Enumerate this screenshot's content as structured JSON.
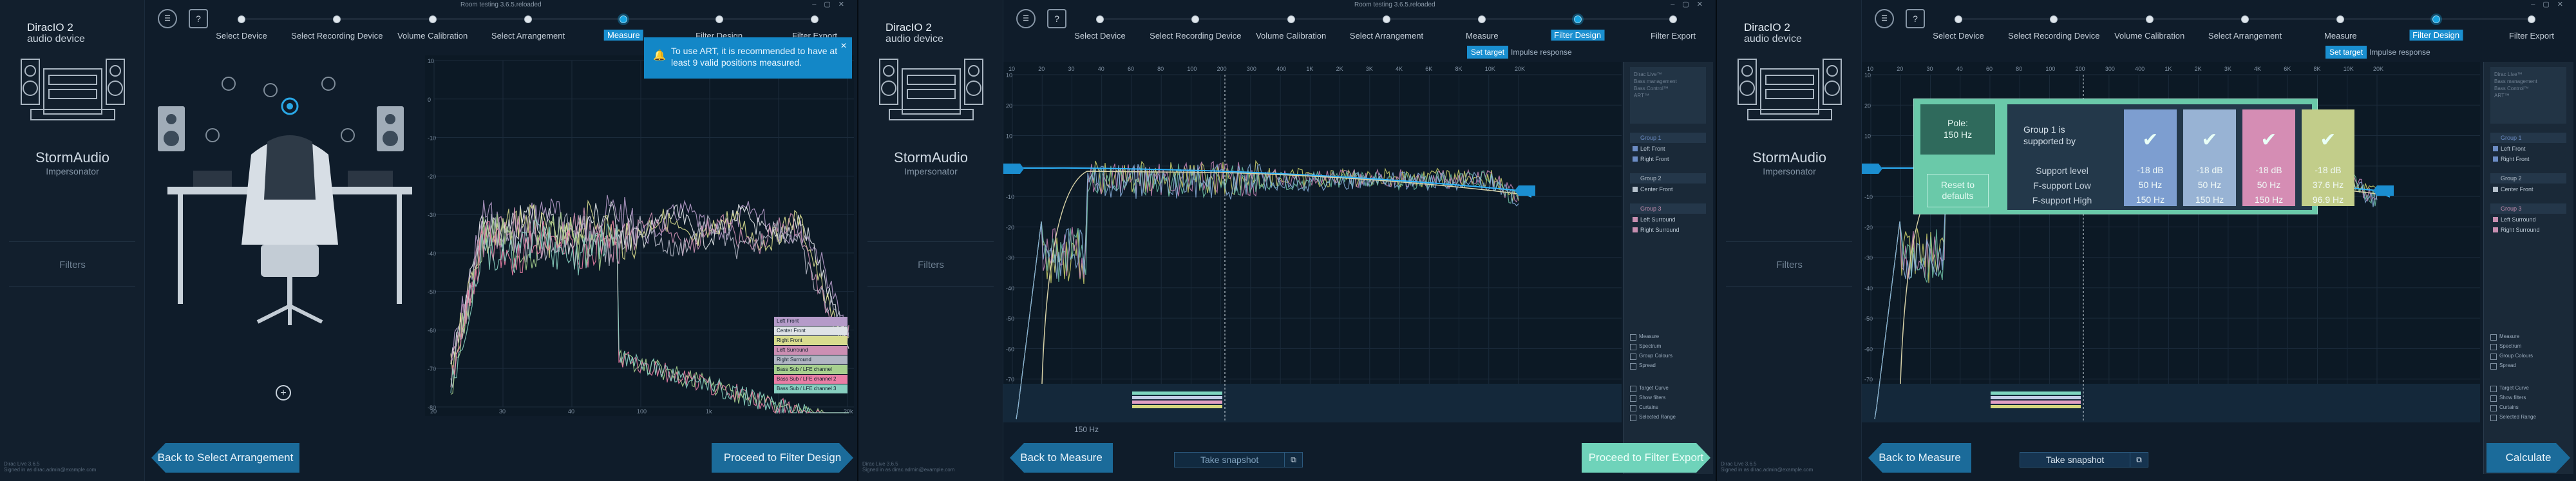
{
  "window": {
    "title": "Room testing 3.6.5.reloaded"
  },
  "app": {
    "brand_line1": "DiracIO 2",
    "brand_line2": "audio device",
    "device": "StormAudio",
    "device_sub": "Impersonator",
    "filters_label": "Filters",
    "version": "Dirac Live 3.6.5",
    "signed_in": "Signed in as dirac.admin@example.com"
  },
  "steps": [
    "Select Device",
    "Select Recording Device",
    "Volume Calibration",
    "Select Arrangement",
    "Measure",
    "Filter Design",
    "Filter Export"
  ],
  "panel1": {
    "active_step": 4,
    "tooltip": "To use ART, it is recommended to have at least 9 valid positions measured.",
    "back": "Back to Select Arrangement",
    "next": "Proceed to Filter Design",
    "y_ticks": [
      "10",
      "0",
      "-10",
      "-20",
      "-30",
      "-40",
      "-50",
      "-60",
      "-70",
      "-80"
    ],
    "x_ticks": [
      "20",
      "30",
      "40",
      "100",
      "1k",
      "10k",
      "20k"
    ],
    "legend": [
      {
        "label": "Left Front",
        "color": "#b59bc9"
      },
      {
        "label": "Center Front",
        "color": "#dfe3e7"
      },
      {
        "label": "Right Front",
        "color": "#d8dc8e"
      },
      {
        "label": "Left Surround",
        "color": "#cc8fb3"
      },
      {
        "label": "Right Surround",
        "color": "#b1b5c3"
      },
      {
        "label": "Bass Sub / LFE channel",
        "color": "#a7d08e"
      },
      {
        "label": "Bass Sub / LFE channel 2",
        "color": "#e97ea5"
      },
      {
        "label": "Bass Sub / LFE channel 3",
        "color": "#87cfc0"
      }
    ]
  },
  "panel2": {
    "active_step": 5,
    "tabs": [
      "Set target",
      "Impulse response"
    ],
    "freq_marker": "150 Hz",
    "back": "Back to Measure",
    "next": "Proceed to Filter Export",
    "snapshot": "Take snapshot",
    "y_ticks": [
      "10",
      "20",
      "10",
      "0",
      "-10",
      "-20",
      "-30",
      "-40",
      "-50",
      "-60",
      "-70",
      "-80"
    ],
    "x_ticks": [
      "10",
      "20",
      "30",
      "40",
      "60",
      "80",
      "100",
      "200",
      "300",
      "400",
      "1K",
      "2K",
      "3K",
      "4K",
      "6K",
      "8K",
      "10K",
      "20K"
    ],
    "rp_top": [
      "Dirac Live™",
      "Bass management",
      "Bass Control™",
      "ART™"
    ],
    "groups": [
      {
        "name": "Group 1",
        "channels": [
          "Left Front",
          "Right Front"
        ],
        "color": "#6c8cc4"
      },
      {
        "name": "Group 2",
        "channels": [
          "Center Front"
        ],
        "color": "#b6c1cc"
      },
      {
        "name": "Group 3",
        "channels": [
          "Left Surround",
          "Right Surround"
        ],
        "color": "#c78fb0"
      }
    ],
    "measure_opts": [
      "Measure",
      "Spectrum",
      "Group Colours",
      "Spread"
    ],
    "target_opts": [
      "Target Curve",
      "Show filters",
      "Curtains",
      "Selected Range"
    ]
  },
  "panel3": {
    "active_step": 5,
    "tabs": [
      "Set target",
      "Impulse response"
    ],
    "back": "Back to Measure",
    "next": "Calculate",
    "snapshot": "Take snapshot",
    "popup": {
      "freq_label": "Pole:",
      "freq_value": "150 Hz",
      "group_text": "Group 1 is supported by",
      "row_labels": [
        "Support level",
        "F-support Low",
        "F-support High"
      ],
      "columns": [
        {
          "color": "#7d9ed0",
          "values": [
            "-18 dB",
            "50 Hz",
            "150 Hz"
          ]
        },
        {
          "color": "#98b3d4",
          "values": [
            "-18 dB",
            "50 Hz",
            "150 Hz"
          ]
        },
        {
          "color": "#d58db4",
          "values": [
            "-18 dB",
            "50 Hz",
            "150 Hz"
          ]
        },
        {
          "color": "#c2cd8a",
          "values": [
            "-18 dB",
            "37.6 Hz",
            "96.9 Hz"
          ]
        }
      ],
      "reset": "Reset to defaults"
    }
  }
}
